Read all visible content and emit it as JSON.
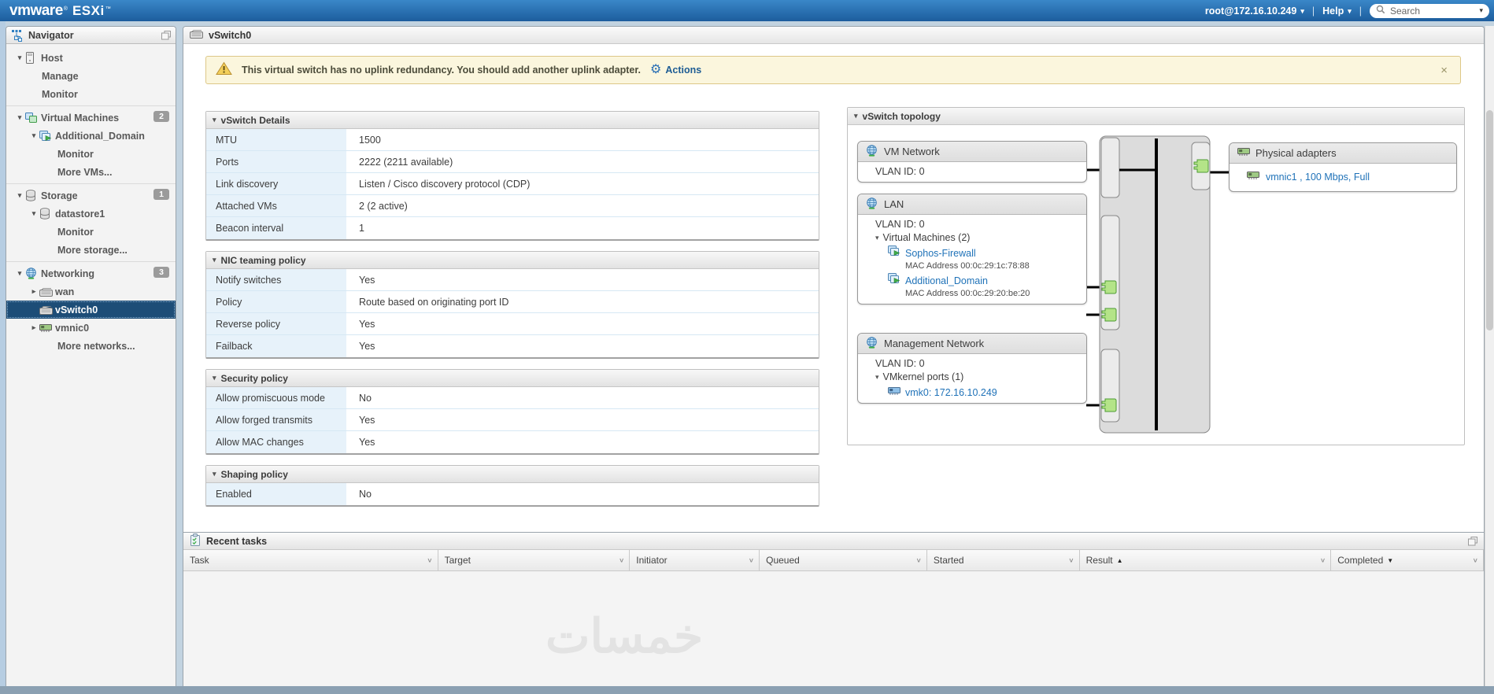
{
  "topbar": {
    "logo_vmware": "vmware",
    "logo_reg": "®",
    "logo_esxi": "ESXi",
    "logo_tm": "™",
    "user": "root@172.16.10.249",
    "help": "Help",
    "search_placeholder": "Search",
    "caret": "▾",
    "divider": "|"
  },
  "navigator": {
    "title": "Navigator",
    "items": [
      {
        "label": "Host",
        "cls": "d0",
        "icon": "host",
        "arrow": "d"
      },
      {
        "label": "Manage",
        "cls": "link1"
      },
      {
        "label": "Monitor",
        "cls": "link1"
      },
      {
        "label": "Virtual Machines",
        "cls": "d0",
        "icon": "vms",
        "arrow": "d",
        "badge": "2",
        "sep": true
      },
      {
        "label": "Additional_Domain",
        "cls": "d1",
        "icon": "vm",
        "arrow": "d"
      },
      {
        "label": "Monitor",
        "cls": "link2"
      },
      {
        "label": "More VMs...",
        "cls": "link2"
      },
      {
        "label": "Storage",
        "cls": "d0",
        "icon": "db",
        "arrow": "d",
        "badge": "1",
        "sep": true
      },
      {
        "label": "datastore1",
        "cls": "d1",
        "icon": "db",
        "arrow": "d"
      },
      {
        "label": "Monitor",
        "cls": "link2"
      },
      {
        "label": "More storage...",
        "cls": "link2"
      },
      {
        "label": "Networking",
        "cls": "d0",
        "icon": "globe",
        "arrow": "d",
        "badge": "3",
        "sep": true
      },
      {
        "label": "wan",
        "cls": "d1",
        "icon": "switch",
        "arrow": "r"
      },
      {
        "label": "vSwitch0",
        "cls": "d1",
        "icon": "switch",
        "selected": true
      },
      {
        "label": "vmnic0",
        "cls": "d1",
        "icon": "nic",
        "arrow": "r"
      },
      {
        "label": "More networks...",
        "cls": "link2"
      }
    ]
  },
  "main": {
    "title": "vSwitch0",
    "warning": {
      "text": "This virtual switch has no uplink redundancy. You should add another uplink adapter.",
      "actions_label": "Actions",
      "gear": "⚙",
      "close": "×"
    },
    "sections": [
      {
        "title": "vSwitch Details",
        "rows": [
          [
            "MTU",
            "1500"
          ],
          [
            "Ports",
            "2222 (2211 available)"
          ],
          [
            "Link discovery",
            "Listen / Cisco discovery protocol (CDP)"
          ],
          [
            "Attached VMs",
            "2 (2 active)"
          ],
          [
            "Beacon interval",
            "1"
          ]
        ]
      },
      {
        "title": "NIC teaming policy",
        "rows": [
          [
            "Notify switches",
            "Yes"
          ],
          [
            "Policy",
            "Route based on originating port ID"
          ],
          [
            "Reverse policy",
            "Yes"
          ],
          [
            "Failback",
            "Yes"
          ]
        ]
      },
      {
        "title": "Security policy",
        "rows": [
          [
            "Allow promiscuous mode",
            "No"
          ],
          [
            "Allow forged transmits",
            "Yes"
          ],
          [
            "Allow MAC changes",
            "Yes"
          ]
        ]
      },
      {
        "title": "Shaping policy",
        "rows": [
          [
            "Enabled",
            "No"
          ]
        ]
      }
    ],
    "topology": {
      "title": "vSwitch topology",
      "vm_network": {
        "name": "VM Network",
        "vlan": "VLAN ID: 0"
      },
      "lan": {
        "name": "LAN",
        "vlan": "VLAN ID: 0",
        "group": "Virtual Machines (2)",
        "vms": [
          {
            "name": "Sophos-Firewall",
            "mac": "MAC Address 00:0c:29:1c:78:88"
          },
          {
            "name": "Additional_Domain",
            "mac": "MAC Address 00:0c:29:20:be:20"
          }
        ]
      },
      "management": {
        "name": "Management Network",
        "vlan": "VLAN ID: 0",
        "group": "VMkernel ports (1)",
        "ports": [
          "vmk0: 172.16.10.249"
        ]
      },
      "physical": {
        "title": "Physical adapters",
        "adapters": [
          "vmnic1 , 100 Mbps, Full"
        ]
      }
    }
  },
  "recent_tasks": {
    "title": "Recent tasks",
    "columns": [
      {
        "label": "Task"
      },
      {
        "label": "Target"
      },
      {
        "label": "Initiator"
      },
      {
        "label": "Queued"
      },
      {
        "label": "Started"
      },
      {
        "label": "Result",
        "sort": "▲"
      },
      {
        "label": "Completed",
        "sort": "▼"
      }
    ]
  },
  "watermark": "خمسات",
  "colors": {
    "topbar_blue_top": "#3a87c8",
    "topbar_blue_bottom": "#1c5d9d",
    "selected_navy": "#1d4d77",
    "link_blue": "#1f72b8",
    "warning_bg": "#fbf6dd",
    "warning_border": "#ddc788",
    "label_cell_bg": "#e7f2fa",
    "port_green": "#b4e488"
  }
}
